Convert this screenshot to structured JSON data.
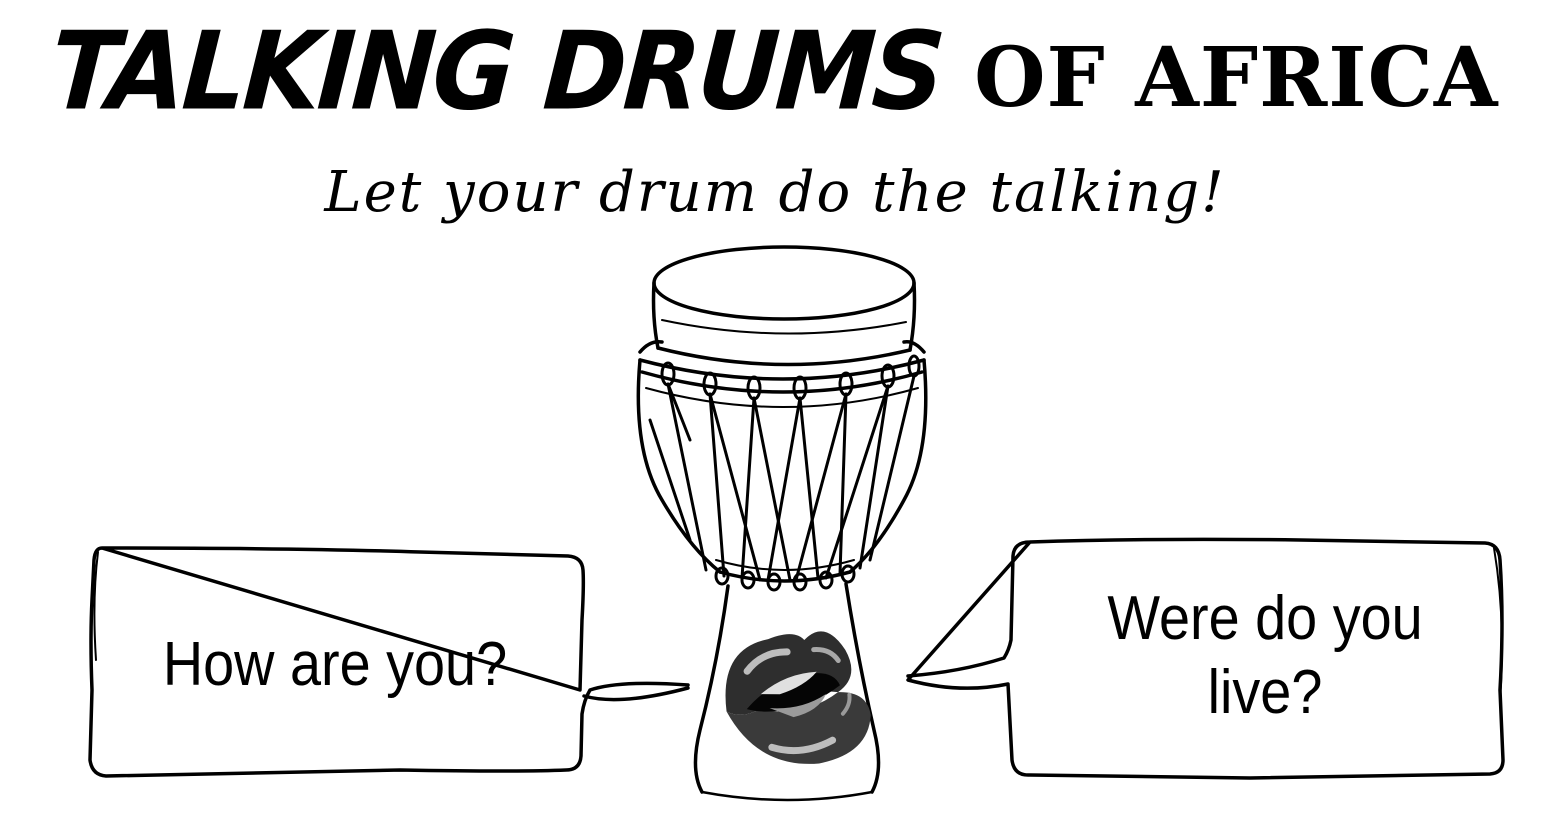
{
  "header": {
    "title_main": "TALKING DRUMS",
    "title_rest": "OF AFRICA",
    "subtitle": "Let your drum do the talking!"
  },
  "speech_bubbles": {
    "left": "How are you?",
    "right_line1": "Were do you",
    "right_line2": "live?"
  },
  "illustration": {
    "subject": "djembe-drum",
    "mouth_icon": "lips-icon"
  },
  "colors": {
    "ink": "#000000",
    "background": "#ffffff",
    "lips_dark": "#2e2e2e",
    "lips_highlight": "#bdbdbd"
  }
}
